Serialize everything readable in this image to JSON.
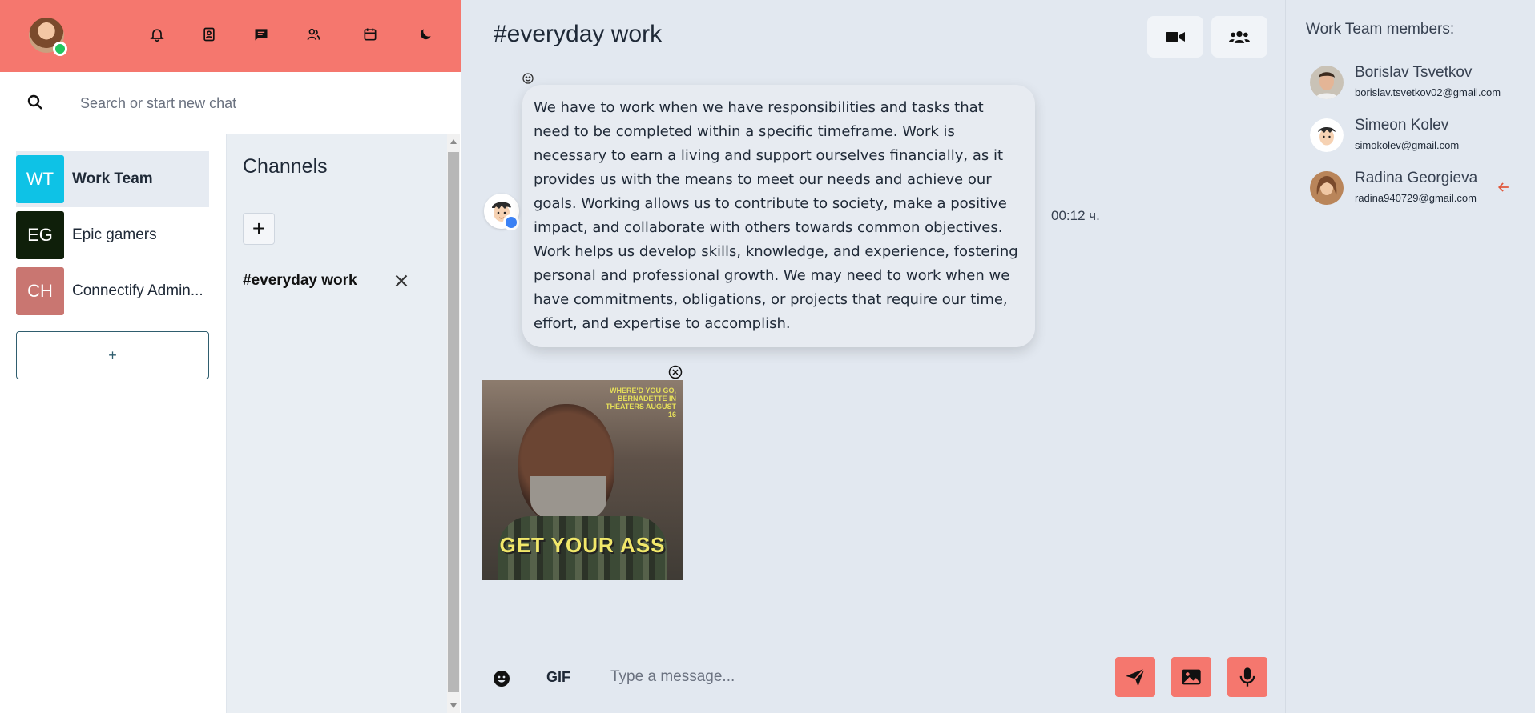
{
  "search": {
    "placeholder": "Search or start new chat"
  },
  "teams": [
    {
      "initials": "WT",
      "name": "Work Team",
      "color": "#0ec2e6",
      "active": true
    },
    {
      "initials": "EG",
      "name": "Epic gamers",
      "color": "#0f1f0a",
      "active": false
    },
    {
      "initials": "CH",
      "name": "Connectify Admin...",
      "color": "#c97671",
      "active": false
    }
  ],
  "add_team_label": "+",
  "channels": {
    "title": "Channels",
    "add_label": "+",
    "items": [
      {
        "name": "#everyday work"
      }
    ]
  },
  "chat": {
    "title": "#everyday work",
    "message": {
      "text": "We have to work when we have responsibilities and tasks that need to be completed within a specific timeframe. Work is necessary to earn a living and support ourselves financially, as it provides us with the means to meet our needs and achieve our goals. Working allows us to contribute to society, make a positive impact, and collaborate with others towards common objectives. Work helps us develop skills, knowledge, and experience, fostering personal and professional growth. We may need to work when we have commitments, obligations, or projects that require our time, effort, and expertise to accomplish.",
      "time": "00:12 ч."
    },
    "gif": {
      "tag": "WHERE'D YOU GO, BERNADETTE IN THEATERS AUGUST 16",
      "caption": "GET YOUR ASS"
    }
  },
  "composer": {
    "gif_label": "GIF",
    "placeholder": "Type a message..."
  },
  "members": {
    "title": "Work Team members:",
    "list": [
      {
        "name": "Borislav Tsvetkov",
        "email": "borislav.tsvetkov02@gmail.com"
      },
      {
        "name": "Simeon Kolev",
        "email": "simokolev@gmail.com"
      },
      {
        "name": "Radina Georgieva",
        "email": "radina940729@gmail.com"
      }
    ]
  },
  "colors": {
    "accent": "#f5776e",
    "background": "#e2e8f0",
    "online": "#22c55e"
  }
}
